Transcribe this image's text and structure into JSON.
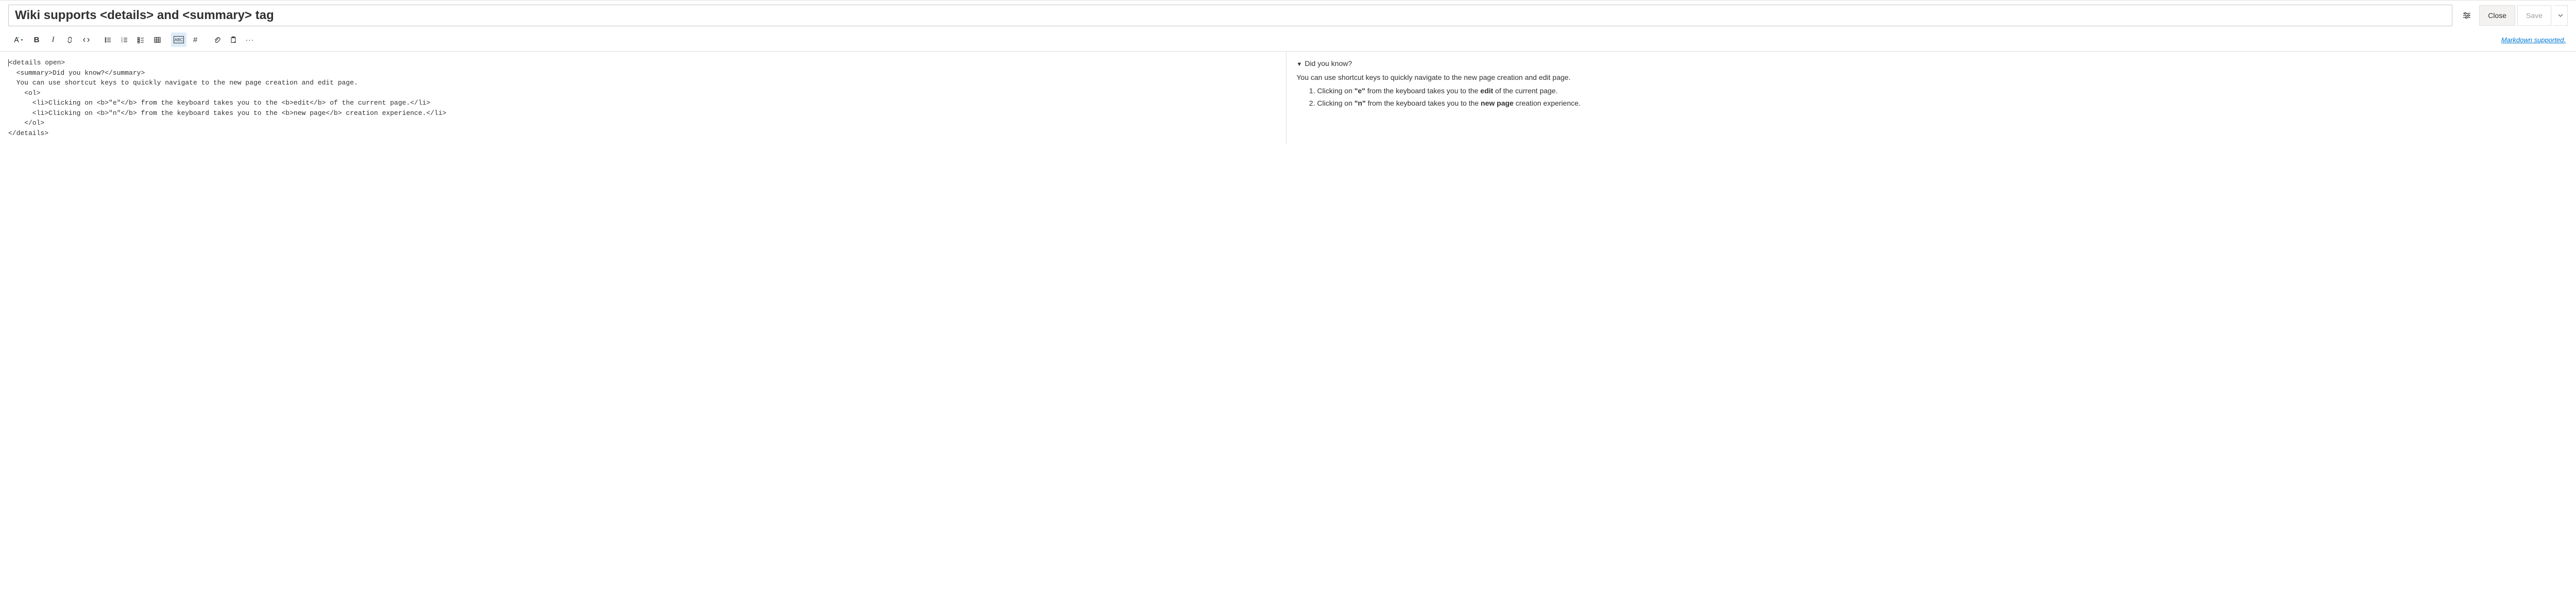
{
  "header": {
    "title_value": "Wiki supports <details> and <summary> tag",
    "close_label": "Close",
    "save_label": "Save"
  },
  "toolbar": {
    "markdown_supported_label": "Markdown supported."
  },
  "editor": {
    "raw": "<details open>\n  <summary>Did you know?</summary>\n  You can use shortcut keys to quickly navigate to the new page creation and edit page.\n    <ol>\n      <li>Clicking on <b>\"e\"</b> from the keyboard takes you to the <b>edit</b> of the current page.</li>\n      <li>Clicking on <b>\"n\"</b> from the keyboard takes you to the <b>new page</b> creation experience.</li>\n    </ol>\n</details>"
  },
  "preview": {
    "summary_text": "Did you know?",
    "intro": "You can use shortcut keys to quickly navigate to the new page creation and edit page.",
    "items": [
      {
        "pre": "Clicking on ",
        "key": "\"e\"",
        "mid": " from the keyboard takes you to the ",
        "bold": "edit",
        "post": " of the current page."
      },
      {
        "pre": "Clicking on ",
        "key": "\"n\"",
        "mid": " from the keyboard takes you to the ",
        "bold": "new page",
        "post": " creation experience."
      }
    ]
  }
}
